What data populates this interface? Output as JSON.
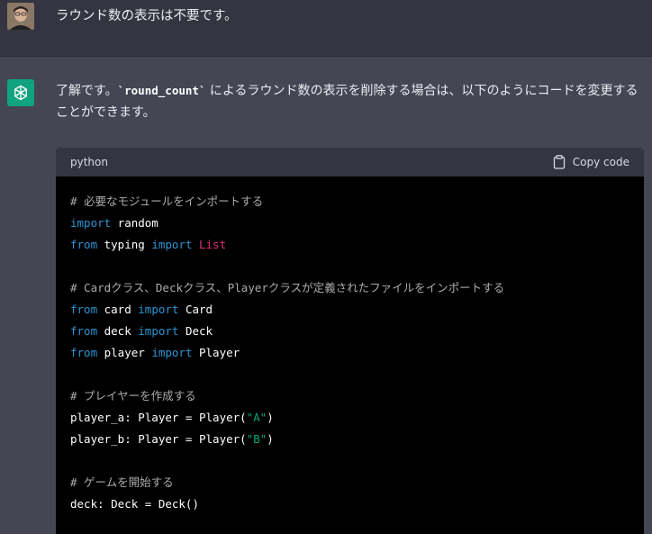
{
  "user_message": {
    "text": "ラウンド数の表示は不要です。"
  },
  "assistant_message": {
    "intro_prefix": "了解です。",
    "inline_code": "`round_count`",
    "intro_suffix": " によるラウンド数の表示を削除する場合は、以下のようにコードを変更することができます。"
  },
  "code_block": {
    "language": "python",
    "copy_label": "Copy code",
    "lines": {
      "c1": "# 必要なモジュールをインポートする",
      "imp1": "import",
      "imp1_name": " random",
      "from2": "from",
      "from2_mod": " typing ",
      "imp2": "import",
      "imp2_name": " List",
      "c2": "# Cardクラス、Deckクラス、Playerクラスが定義されたファイルをインポートする",
      "from3": "from",
      "from3_mod": " card ",
      "imp3": "import",
      "imp3_name": " Card",
      "from4": "from",
      "from4_mod": " deck ",
      "imp4": "import",
      "imp4_name": " Deck",
      "from5": "from",
      "from5_mod": " player ",
      "imp5": "import",
      "imp5_name": " Player",
      "c3": "# プレイヤーを作成する",
      "pa_prefix": "player_a: Player = Player(",
      "pa_str": "\"A\"",
      "pa_suffix": ")",
      "pb_prefix": "player_b: Player = Player(",
      "pb_str": "\"B\"",
      "pb_suffix": ")",
      "c4": "# ゲームを開始する",
      "deck_line": "deck: Deck = Deck()"
    }
  },
  "colors": {
    "keyword": "#2e95d3",
    "name_highlight": "#df3079",
    "string": "#00a67d",
    "comment": "#aaaaaa"
  },
  "icons": {
    "bot_avatar": "openai-logo-icon",
    "copy": "clipboard-icon"
  }
}
